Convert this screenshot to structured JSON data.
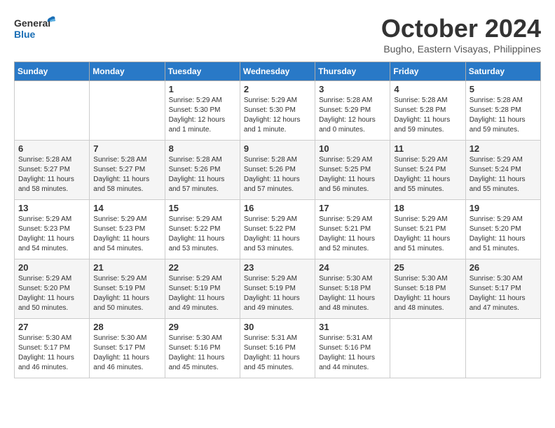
{
  "logo": {
    "text_general": "General",
    "text_blue": "Blue"
  },
  "title": "October 2024",
  "subtitle": "Bugho, Eastern Visayas, Philippines",
  "weekdays": [
    "Sunday",
    "Monday",
    "Tuesday",
    "Wednesday",
    "Thursday",
    "Friday",
    "Saturday"
  ],
  "weeks": [
    [
      {
        "day": "",
        "sunrise": "",
        "sunset": "",
        "daylight": ""
      },
      {
        "day": "",
        "sunrise": "",
        "sunset": "",
        "daylight": ""
      },
      {
        "day": "1",
        "sunrise": "Sunrise: 5:29 AM",
        "sunset": "Sunset: 5:30 PM",
        "daylight": "Daylight: 12 hours and 1 minute."
      },
      {
        "day": "2",
        "sunrise": "Sunrise: 5:29 AM",
        "sunset": "Sunset: 5:30 PM",
        "daylight": "Daylight: 12 hours and 1 minute."
      },
      {
        "day": "3",
        "sunrise": "Sunrise: 5:28 AM",
        "sunset": "Sunset: 5:29 PM",
        "daylight": "Daylight: 12 hours and 0 minutes."
      },
      {
        "day": "4",
        "sunrise": "Sunrise: 5:28 AM",
        "sunset": "Sunset: 5:28 PM",
        "daylight": "Daylight: 11 hours and 59 minutes."
      },
      {
        "day": "5",
        "sunrise": "Sunrise: 5:28 AM",
        "sunset": "Sunset: 5:28 PM",
        "daylight": "Daylight: 11 hours and 59 minutes."
      }
    ],
    [
      {
        "day": "6",
        "sunrise": "Sunrise: 5:28 AM",
        "sunset": "Sunset: 5:27 PM",
        "daylight": "Daylight: 11 hours and 58 minutes."
      },
      {
        "day": "7",
        "sunrise": "Sunrise: 5:28 AM",
        "sunset": "Sunset: 5:27 PM",
        "daylight": "Daylight: 11 hours and 58 minutes."
      },
      {
        "day": "8",
        "sunrise": "Sunrise: 5:28 AM",
        "sunset": "Sunset: 5:26 PM",
        "daylight": "Daylight: 11 hours and 57 minutes."
      },
      {
        "day": "9",
        "sunrise": "Sunrise: 5:28 AM",
        "sunset": "Sunset: 5:26 PM",
        "daylight": "Daylight: 11 hours and 57 minutes."
      },
      {
        "day": "10",
        "sunrise": "Sunrise: 5:29 AM",
        "sunset": "Sunset: 5:25 PM",
        "daylight": "Daylight: 11 hours and 56 minutes."
      },
      {
        "day": "11",
        "sunrise": "Sunrise: 5:29 AM",
        "sunset": "Sunset: 5:24 PM",
        "daylight": "Daylight: 11 hours and 55 minutes."
      },
      {
        "day": "12",
        "sunrise": "Sunrise: 5:29 AM",
        "sunset": "Sunset: 5:24 PM",
        "daylight": "Daylight: 11 hours and 55 minutes."
      }
    ],
    [
      {
        "day": "13",
        "sunrise": "Sunrise: 5:29 AM",
        "sunset": "Sunset: 5:23 PM",
        "daylight": "Daylight: 11 hours and 54 minutes."
      },
      {
        "day": "14",
        "sunrise": "Sunrise: 5:29 AM",
        "sunset": "Sunset: 5:23 PM",
        "daylight": "Daylight: 11 hours and 54 minutes."
      },
      {
        "day": "15",
        "sunrise": "Sunrise: 5:29 AM",
        "sunset": "Sunset: 5:22 PM",
        "daylight": "Daylight: 11 hours and 53 minutes."
      },
      {
        "day": "16",
        "sunrise": "Sunrise: 5:29 AM",
        "sunset": "Sunset: 5:22 PM",
        "daylight": "Daylight: 11 hours and 53 minutes."
      },
      {
        "day": "17",
        "sunrise": "Sunrise: 5:29 AM",
        "sunset": "Sunset: 5:21 PM",
        "daylight": "Daylight: 11 hours and 52 minutes."
      },
      {
        "day": "18",
        "sunrise": "Sunrise: 5:29 AM",
        "sunset": "Sunset: 5:21 PM",
        "daylight": "Daylight: 11 hours and 51 minutes."
      },
      {
        "day": "19",
        "sunrise": "Sunrise: 5:29 AM",
        "sunset": "Sunset: 5:20 PM",
        "daylight": "Daylight: 11 hours and 51 minutes."
      }
    ],
    [
      {
        "day": "20",
        "sunrise": "Sunrise: 5:29 AM",
        "sunset": "Sunset: 5:20 PM",
        "daylight": "Daylight: 11 hours and 50 minutes."
      },
      {
        "day": "21",
        "sunrise": "Sunrise: 5:29 AM",
        "sunset": "Sunset: 5:19 PM",
        "daylight": "Daylight: 11 hours and 50 minutes."
      },
      {
        "day": "22",
        "sunrise": "Sunrise: 5:29 AM",
        "sunset": "Sunset: 5:19 PM",
        "daylight": "Daylight: 11 hours and 49 minutes."
      },
      {
        "day": "23",
        "sunrise": "Sunrise: 5:29 AM",
        "sunset": "Sunset: 5:19 PM",
        "daylight": "Daylight: 11 hours and 49 minutes."
      },
      {
        "day": "24",
        "sunrise": "Sunrise: 5:30 AM",
        "sunset": "Sunset: 5:18 PM",
        "daylight": "Daylight: 11 hours and 48 minutes."
      },
      {
        "day": "25",
        "sunrise": "Sunrise: 5:30 AM",
        "sunset": "Sunset: 5:18 PM",
        "daylight": "Daylight: 11 hours and 48 minutes."
      },
      {
        "day": "26",
        "sunrise": "Sunrise: 5:30 AM",
        "sunset": "Sunset: 5:17 PM",
        "daylight": "Daylight: 11 hours and 47 minutes."
      }
    ],
    [
      {
        "day": "27",
        "sunrise": "Sunrise: 5:30 AM",
        "sunset": "Sunset: 5:17 PM",
        "daylight": "Daylight: 11 hours and 46 minutes."
      },
      {
        "day": "28",
        "sunrise": "Sunrise: 5:30 AM",
        "sunset": "Sunset: 5:17 PM",
        "daylight": "Daylight: 11 hours and 46 minutes."
      },
      {
        "day": "29",
        "sunrise": "Sunrise: 5:30 AM",
        "sunset": "Sunset: 5:16 PM",
        "daylight": "Daylight: 11 hours and 45 minutes."
      },
      {
        "day": "30",
        "sunrise": "Sunrise: 5:31 AM",
        "sunset": "Sunset: 5:16 PM",
        "daylight": "Daylight: 11 hours and 45 minutes."
      },
      {
        "day": "31",
        "sunrise": "Sunrise: 5:31 AM",
        "sunset": "Sunset: 5:16 PM",
        "daylight": "Daylight: 11 hours and 44 minutes."
      },
      {
        "day": "",
        "sunrise": "",
        "sunset": "",
        "daylight": ""
      },
      {
        "day": "",
        "sunrise": "",
        "sunset": "",
        "daylight": ""
      }
    ]
  ]
}
